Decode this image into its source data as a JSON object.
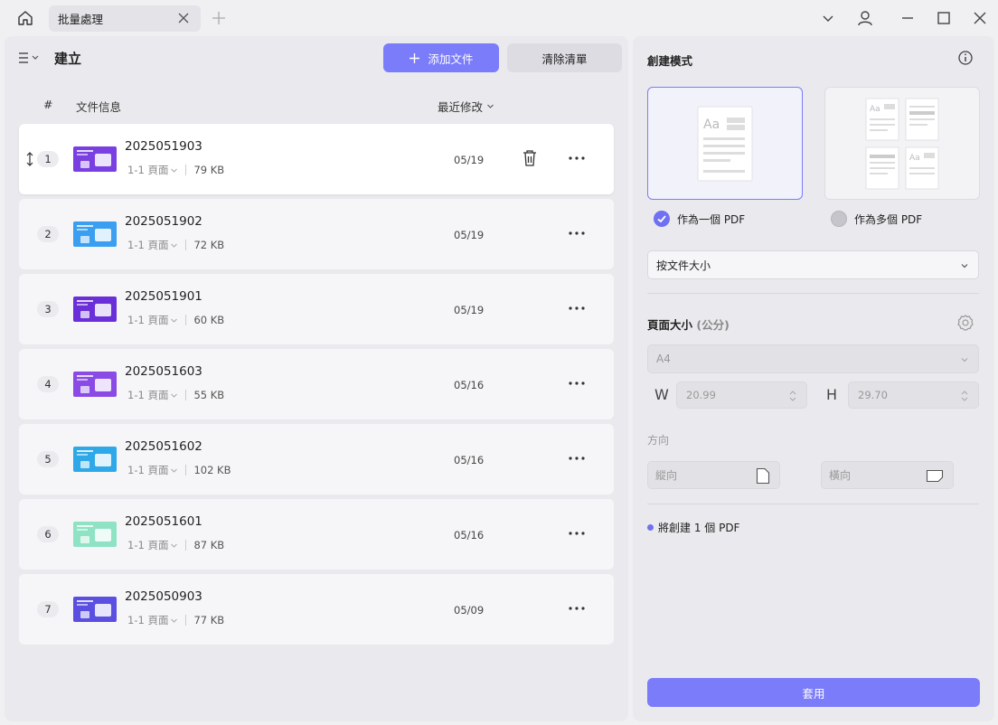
{
  "titlebar": {
    "tab_label": "批量處理"
  },
  "left": {
    "title": "建立",
    "add_button": "添加文件",
    "clear_button": "清除清單",
    "header": {
      "num": "#",
      "info": "文件信息",
      "modified": "最近修改"
    },
    "files": [
      {
        "index": "1",
        "name": "2025051903",
        "pages": "1-1 頁面",
        "size": "79 KB",
        "date": "05/19",
        "thumb_color": "#7a3fe0"
      },
      {
        "index": "2",
        "name": "2025051902",
        "pages": "1-1 頁面",
        "size": "72 KB",
        "date": "05/19",
        "thumb_color": "#3a9ff0"
      },
      {
        "index": "3",
        "name": "2025051901",
        "pages": "1-1 頁面",
        "size": "60 KB",
        "date": "05/19",
        "thumb_color": "#6a2fd8"
      },
      {
        "index": "4",
        "name": "2025051603",
        "pages": "1-1 頁面",
        "size": "55 KB",
        "date": "05/16",
        "thumb_color": "#8a4ae6"
      },
      {
        "index": "5",
        "name": "2025051602",
        "pages": "1-1 頁面",
        "size": "102 KB",
        "date": "05/16",
        "thumb_color": "#2ea8e8"
      },
      {
        "index": "6",
        "name": "2025051601",
        "pages": "1-1 頁面",
        "size": "87 KB",
        "date": "05/16",
        "thumb_color": "#8fe3c4"
      },
      {
        "index": "7",
        "name": "2025050903",
        "pages": "1-1 頁面",
        "size": "77 KB",
        "date": "05/09",
        "thumb_color": "#5a4fe0"
      }
    ]
  },
  "right": {
    "title": "創建模式",
    "mode_single": "作為一個 PDF",
    "mode_multi": "作為多個 PDF",
    "split_select": "按文件大小",
    "page_size_label": "頁面大小",
    "page_size_unit": "(公分)",
    "paper_select": "A4",
    "w_label": "W",
    "h_label": "H",
    "width_value": "20.99",
    "height_value": "29.70",
    "orientation_label": "方向",
    "portrait": "縱向",
    "landscape": "橫向",
    "status": "將創建 1 個 PDF",
    "apply_button": "套用"
  },
  "colors": {
    "accent": "#7b7cfa"
  }
}
